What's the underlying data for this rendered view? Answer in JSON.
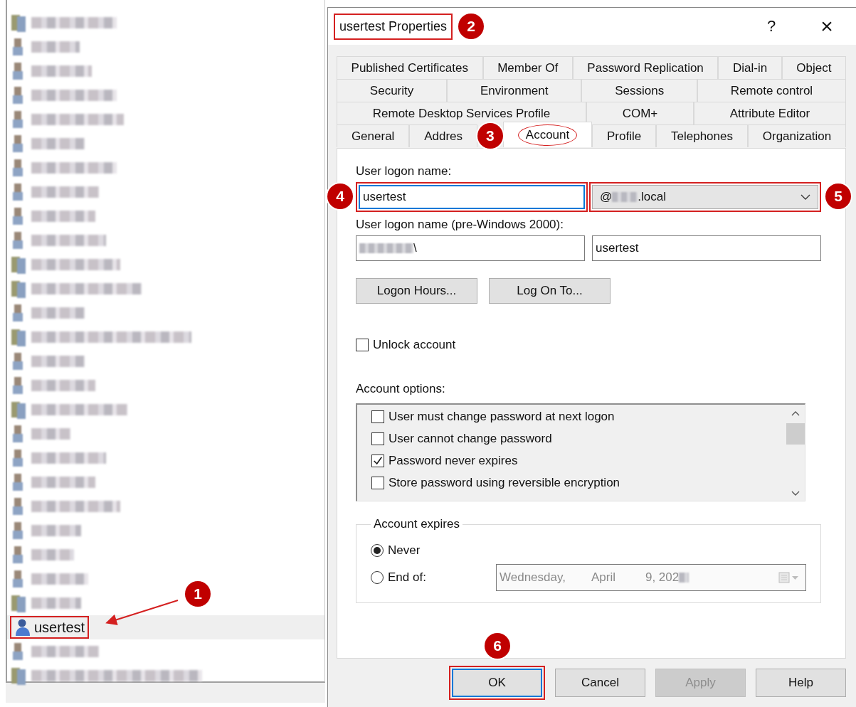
{
  "tree": {
    "items": [
      {
        "kind": "group",
        "selected": false
      },
      {
        "kind": "user",
        "selected": false
      },
      {
        "kind": "user",
        "selected": false
      },
      {
        "kind": "user",
        "selected": false
      },
      {
        "kind": "user",
        "selected": false
      },
      {
        "kind": "user",
        "selected": false
      },
      {
        "kind": "user",
        "selected": false
      },
      {
        "kind": "user",
        "selected": false
      },
      {
        "kind": "user",
        "selected": false
      },
      {
        "kind": "user",
        "selected": false
      },
      {
        "kind": "group",
        "selected": false
      },
      {
        "kind": "group",
        "selected": false
      },
      {
        "kind": "user",
        "selected": false
      },
      {
        "kind": "group",
        "selected": false
      },
      {
        "kind": "user",
        "selected": false
      },
      {
        "kind": "user",
        "selected": false
      },
      {
        "kind": "group",
        "selected": false
      },
      {
        "kind": "user",
        "selected": false
      },
      {
        "kind": "user",
        "selected": false
      },
      {
        "kind": "user",
        "selected": false
      },
      {
        "kind": "user",
        "selected": false
      },
      {
        "kind": "user",
        "selected": false
      },
      {
        "kind": "user",
        "selected": false
      },
      {
        "kind": "user",
        "selected": false
      },
      {
        "kind": "group",
        "selected": false
      },
      {
        "kind": "named",
        "label": "usertest",
        "selected": true,
        "badge": "1"
      },
      {
        "kind": "user",
        "selected": false
      },
      {
        "kind": "group",
        "selected": false
      }
    ]
  },
  "dialog": {
    "title": "usertest Properties",
    "title_badge": "2",
    "help": "?",
    "close": "×",
    "tabs": [
      [
        {
          "label": "Published Certificates",
          "selected": false
        },
        {
          "label": "Member Of",
          "selected": false
        },
        {
          "label": "Password Replication",
          "selected": false
        },
        {
          "label": "Dial-in",
          "selected": false
        },
        {
          "label": "Object",
          "selected": false
        }
      ],
      [
        {
          "label": "Security",
          "selected": false
        },
        {
          "label": "Environment",
          "selected": false
        },
        {
          "label": "Sessions",
          "selected": false
        },
        {
          "label": "Remote control",
          "selected": false
        }
      ],
      [
        {
          "label": "Remote Desktop Services Profile",
          "selected": false
        },
        {
          "label": "COM+",
          "selected": false
        },
        {
          "label": "Attribute Editor",
          "selected": false
        }
      ],
      [
        {
          "label": "General",
          "selected": false
        },
        {
          "label": "Addres",
          "selected": false
        },
        {
          "label": "Account",
          "selected": true,
          "badge": "3"
        },
        {
          "label": "Profile",
          "selected": false
        },
        {
          "label": "Telephones",
          "selected": false
        },
        {
          "label": "Organization",
          "selected": false
        }
      ]
    ],
    "account": {
      "logon_label": "User logon name:",
      "logon_name": {
        "value": "usertest",
        "focused": true,
        "badge": "4"
      },
      "domain": {
        "prefix": "@",
        "suffix": ".local",
        "badge": "5"
      },
      "pre2000_label": "User logon name (pre-Windows 2000):",
      "pre2000_domain": {
        "suffix": "\\"
      },
      "pre2000_name": {
        "value": "usertest"
      },
      "buttons": [
        "Logon Hours...",
        "Log On To..."
      ],
      "unlock": {
        "label": "Unlock account",
        "checked": false
      },
      "options_label": "Account options:",
      "options": [
        {
          "label": "User must change password at next logon",
          "checked": false
        },
        {
          "label": "User cannot change password",
          "checked": false
        },
        {
          "label": "Password never expires",
          "checked": true
        },
        {
          "label": "Store password using reversible encryption",
          "checked": false
        }
      ],
      "expires": {
        "legend": "Account expires",
        "choices": [
          {
            "label": "Never",
            "selected": true
          },
          {
            "label": "End of:",
            "selected": false
          }
        ],
        "date": {
          "weekday": "Wednesday,",
          "month": "April",
          "day_year": "9, 202"
        }
      }
    },
    "buttons": [
      {
        "label": "OK",
        "default": true,
        "disabled": false,
        "badge": "6"
      },
      {
        "label": "Cancel",
        "default": false,
        "disabled": false
      },
      {
        "label": "Apply",
        "default": false,
        "disabled": true
      },
      {
        "label": "Help",
        "default": false,
        "disabled": false
      }
    ]
  }
}
